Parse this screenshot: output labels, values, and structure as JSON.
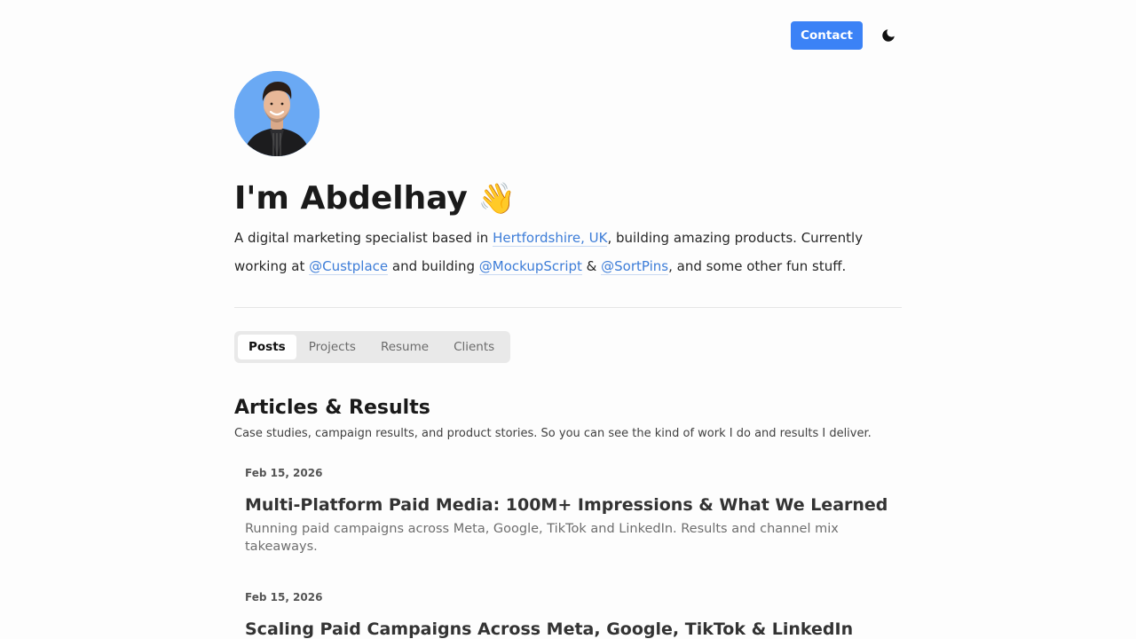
{
  "header": {
    "contact_label": "Contact",
    "theme_icon": "moon-icon"
  },
  "profile": {
    "avatar": "avatar-photo",
    "title": "I'm Abdelhay",
    "wave_emoji": "👋",
    "bio": {
      "part1": "A digital marketing specialist based in ",
      "location_link": "Hertfordshire, UK",
      "part2": ", building amazing products. Currently working at ",
      "custplace_link": "@Custplace",
      "part3": " and building ",
      "mockupscript_link": "@MockupScript",
      "part4": " & ",
      "sortpins_link": "@SortPins",
      "part5": ", and some other fun stuff."
    }
  },
  "tabs": [
    {
      "label": "Posts",
      "active": true
    },
    {
      "label": "Projects",
      "active": false
    },
    {
      "label": "Resume",
      "active": false
    },
    {
      "label": "Clients",
      "active": false
    }
  ],
  "section": {
    "title": "Articles & Results",
    "subtitle": "Case studies, campaign results, and product stories. So you can see the kind of work I do and results I deliver."
  },
  "posts": [
    {
      "date": "Feb 15, 2026",
      "title": "Multi-Platform Paid Media: 100M+ Impressions & What We Learned",
      "description": "Running paid campaigns across Meta, Google, TikTok and LinkedIn. Results and channel mix takeaways."
    },
    {
      "date": "Feb 15, 2026",
      "title": "Scaling Paid Campaigns Across Meta, Google, TikTok & LinkedIn",
      "description": ""
    }
  ],
  "colors": {
    "accent": "#3b82f6",
    "link": "#3d7dd8",
    "background": "#fdfdfd"
  }
}
